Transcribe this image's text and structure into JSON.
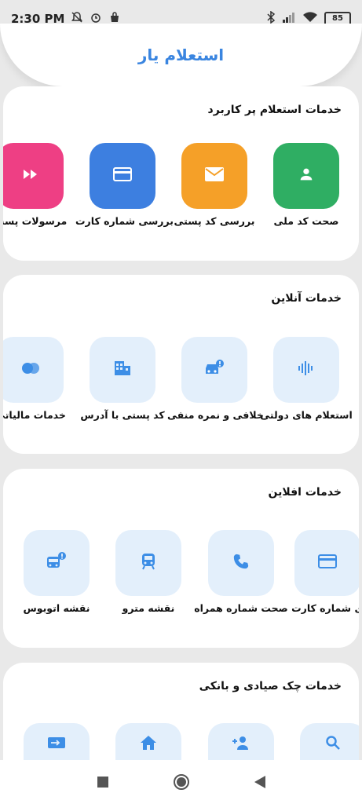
{
  "status_bar": {
    "time": "2:30 PM",
    "battery": "85"
  },
  "header": {
    "title": "استعلام یار"
  },
  "sections": {
    "popular": {
      "title": "خدمات استعلام پر کاربرد",
      "items": [
        {
          "label": "صحت کد ملی",
          "icon": "person-icon",
          "color": "#2fae63"
        },
        {
          "label": "بررسی کد پستی",
          "icon": "envelope-icon",
          "color": "#f5a028"
        },
        {
          "label": "بررسی شماره کارت",
          "icon": "credit-card-icon",
          "color": "#3d7fe0"
        },
        {
          "label": "مرسولات پست",
          "icon": "fast-forward-icon",
          "color": "#ee3f84"
        }
      ]
    },
    "online": {
      "title": "خدمات آنلاین",
      "items": [
        {
          "label": "استعلام های دولتی",
          "icon": "voice-wave-icon"
        },
        {
          "label": "خلافی و نمره منفی",
          "icon": "car-alert-icon"
        },
        {
          "label": "کد پستی با آدرس",
          "icon": "building-icon"
        },
        {
          "label": "خدمات مالیاتی",
          "icon": "circles-icon"
        }
      ]
    },
    "offline": {
      "title": "خدمات افلاین",
      "items": [
        {
          "label": "ی شماره کارت",
          "icon": "credit-card-icon"
        },
        {
          "label": "صحت شماره همراه",
          "icon": "phone-icon"
        },
        {
          "label": "نقشه مترو",
          "icon": "train-icon"
        },
        {
          "label": "نقشه اتوبوس",
          "icon": "bus-alert-icon"
        }
      ]
    },
    "cheque": {
      "title": "خدمات چک صیادی و بانکی",
      "items": [
        {
          "label": "",
          "icon": "search-icon"
        },
        {
          "label": "",
          "icon": "person-add-icon"
        },
        {
          "label": "",
          "icon": "home-icon"
        },
        {
          "label": "",
          "icon": "ticket-icon"
        }
      ]
    }
  },
  "theme": {
    "accent": "#3a85e0",
    "tile_light": "#e3effb",
    "icon_blue": "#3d8ee6"
  }
}
